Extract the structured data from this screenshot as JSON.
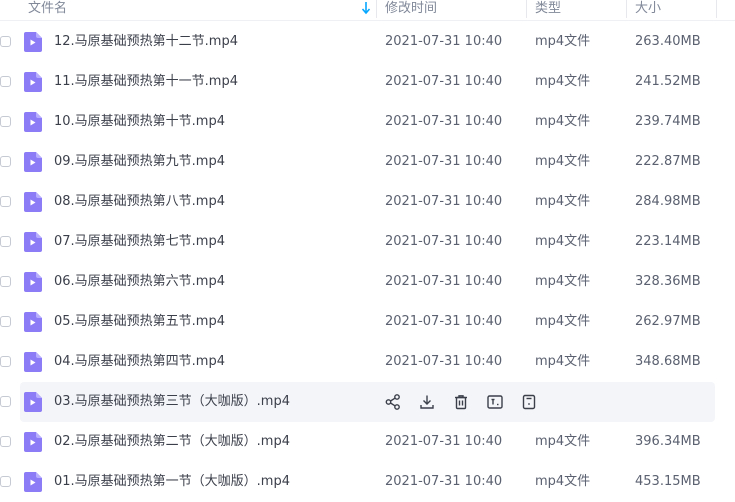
{
  "header": {
    "col_name": "文件名",
    "col_modified": "修改时间",
    "col_type": "类型",
    "col_size": "大小"
  },
  "colors": {
    "accent": "#06a7ff",
    "video_icon": "#8c7cf5",
    "hover_row": "#f4f5f9"
  },
  "files": [
    {
      "name": "12.马原基础预热第十二节.mp4",
      "modified": "2021-07-31 10:40",
      "type": "mp4文件",
      "size": "263.40MB"
    },
    {
      "name": "11.马原基础预热第十一节.mp4",
      "modified": "2021-07-31 10:40",
      "type": "mp4文件",
      "size": "241.52MB"
    },
    {
      "name": "10.马原基础预热第十节.mp4",
      "modified": "2021-07-31 10:40",
      "type": "mp4文件",
      "size": "239.74MB"
    },
    {
      "name": "09.马原基础预热第九节.mp4",
      "modified": "2021-07-31 10:40",
      "type": "mp4文件",
      "size": "222.87MB"
    },
    {
      "name": "08.马原基础预热第八节.mp4",
      "modified": "2021-07-31 10:40",
      "type": "mp4文件",
      "size": "284.98MB"
    },
    {
      "name": "07.马原基础预热第七节.mp4",
      "modified": "2021-07-31 10:40",
      "type": "mp4文件",
      "size": "223.14MB"
    },
    {
      "name": "06.马原基础预热第六节.mp4",
      "modified": "2021-07-31 10:40",
      "type": "mp4文件",
      "size": "328.36MB"
    },
    {
      "name": "05.马原基础预热第五节.mp4",
      "modified": "2021-07-31 10:40",
      "type": "mp4文件",
      "size": "262.97MB"
    },
    {
      "name": "04.马原基础预热第四节.mp4",
      "modified": "2021-07-31 10:40",
      "type": "mp4文件",
      "size": "348.68MB"
    },
    {
      "name": "03.马原基础预热第三节（大咖版）.mp4",
      "hovered": true,
      "actions": [
        "share-icon",
        "download-icon",
        "delete-icon",
        "rename-icon",
        "more-icon"
      ]
    },
    {
      "name": "02.马原基础预热第二节（大咖版）.mp4",
      "modified": "2021-07-31 10:40",
      "type": "mp4文件",
      "size": "396.34MB"
    },
    {
      "name": "01.马原基础预热第一节（大咖版）.mp4",
      "modified": "2021-07-31 10:40",
      "type": "mp4文件",
      "size": "453.15MB"
    }
  ]
}
